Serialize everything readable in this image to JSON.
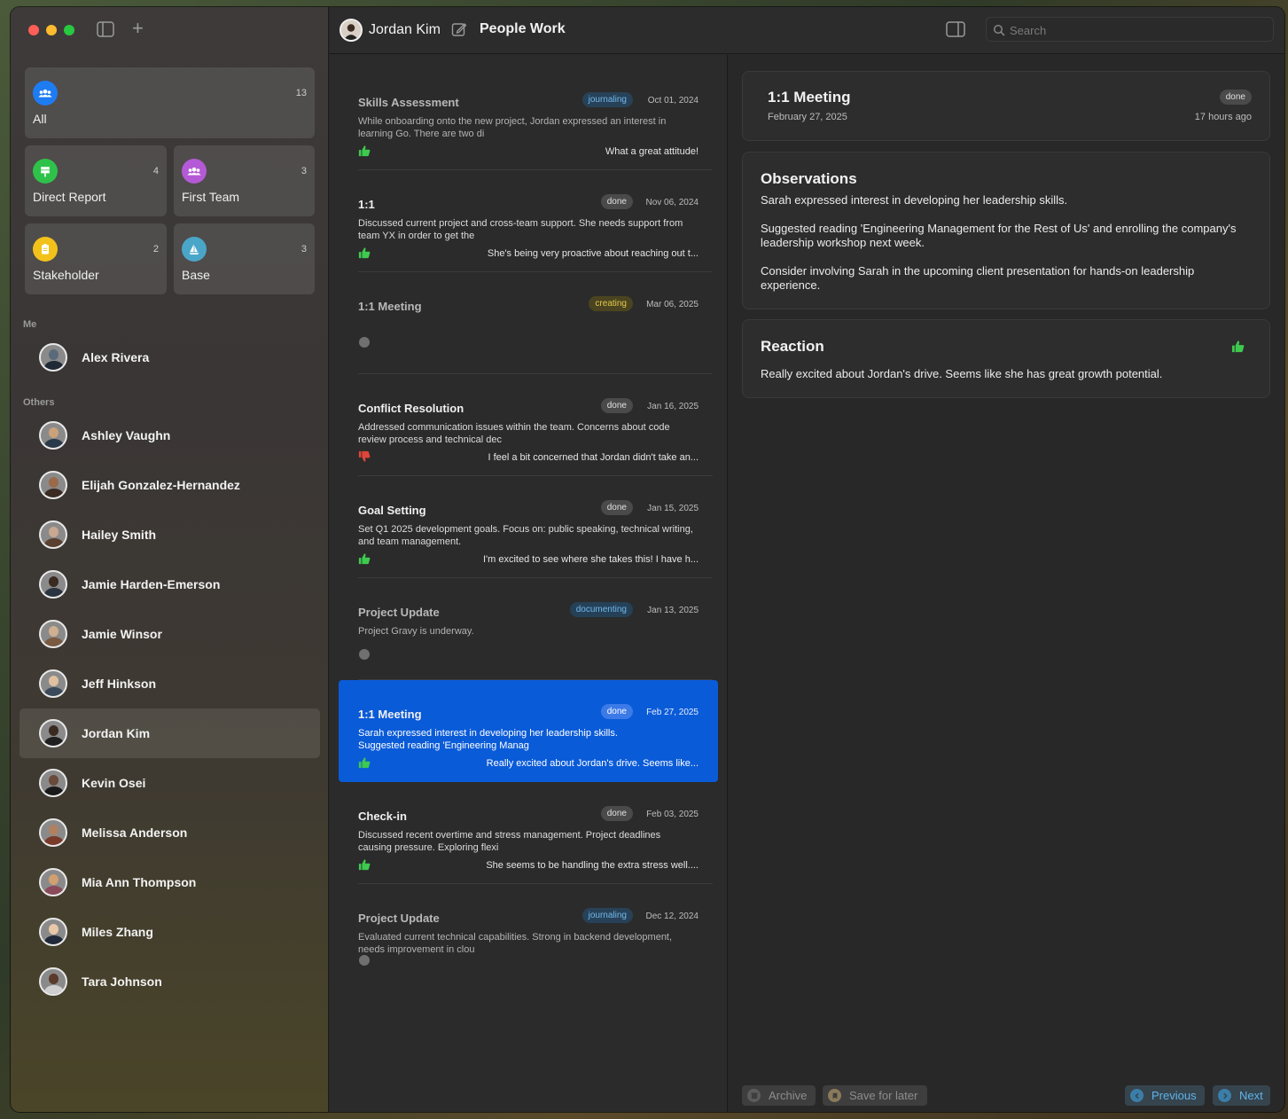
{
  "header": {
    "person_name": "Jordan Kim",
    "app_title": "People Work",
    "search_placeholder": "Search"
  },
  "sidebar": {
    "groups": [
      {
        "label": "All",
        "count": "13",
        "color": "#1e7cf2",
        "icon": "people-group-icon"
      },
      {
        "label": "Direct Report",
        "count": "4",
        "color": "#2fc24a",
        "icon": "signpost-icon"
      },
      {
        "label": "First Team",
        "count": "3",
        "color": "#b45ad6",
        "icon": "people-group-icon"
      },
      {
        "label": "Stakeholder",
        "count": "2",
        "color": "#f2c21a",
        "icon": "clipboard-icon"
      },
      {
        "label": "Base",
        "count": "3",
        "color": "#4aa6c8",
        "icon": "sailboat-icon"
      }
    ],
    "me_label": "Me",
    "me": [
      {
        "name": "Alex Rivera"
      }
    ],
    "others_label": "Others",
    "others": [
      {
        "name": "Ashley Vaughn"
      },
      {
        "name": "Elijah Gonzalez-Hernandez"
      },
      {
        "name": "Hailey Smith"
      },
      {
        "name": "Jamie Harden-Emerson"
      },
      {
        "name": "Jamie Winsor"
      },
      {
        "name": "Jeff Hinkson"
      },
      {
        "name": "Jordan Kim",
        "selected": true
      },
      {
        "name": "Kevin Osei"
      },
      {
        "name": "Melissa Anderson"
      },
      {
        "name": "Mia Ann Thompson"
      },
      {
        "name": "Miles Zhang"
      },
      {
        "name": "Tara Johnson"
      }
    ]
  },
  "list": {
    "items": [
      {
        "title": "Skills Assessment",
        "status": "journaling",
        "date": "Oct 01, 2024",
        "snippet": "While onboarding onto the new project, Jordan expressed an interest in learning Go. There are two di",
        "reaction": "What a great attitude!",
        "sentiment": "positive"
      },
      {
        "title": "1:1",
        "status": "done",
        "date": "Nov 06, 2024",
        "snippet": "Discussed current project and cross-team support. She needs support from team YX in order to get the",
        "reaction": "She's being very proactive about reaching out t...",
        "sentiment": "positive"
      },
      {
        "title": "1:1 Meeting",
        "status": "creating",
        "date": "Mar 06, 2025",
        "snippet": "",
        "reaction": "",
        "sentiment": "none"
      },
      {
        "title": "Conflict Resolution",
        "status": "done",
        "date": "Jan 16, 2025",
        "snippet": "Addressed communication issues within the team. Concerns about code review process and technical dec",
        "reaction": "I feel a bit concerned that Jordan didn't take an...",
        "sentiment": "negative"
      },
      {
        "title": "Goal Setting",
        "status": "done",
        "date": "Jan 15, 2025",
        "snippet": "Set Q1 2025 development goals.   Focus on: public speaking, technical writing, and team management.",
        "reaction": "I'm excited to see where she takes this! I have h...",
        "sentiment": "positive"
      },
      {
        "title": "Project Update",
        "status": "documenting",
        "date": "Jan 13, 2025",
        "snippet": "Project Gravy is underway.",
        "reaction": "",
        "sentiment": "none"
      },
      {
        "title": "1:1 Meeting",
        "status": "done",
        "date": "Feb 27, 2025",
        "snippet": "Sarah expressed interest in developing her leadership skills.\nSuggested reading 'Engineering Manag",
        "reaction": "Really excited about Jordan's drive. Seems like...",
        "sentiment": "positive",
        "selected": true
      },
      {
        "title": "Check-in",
        "status": "done",
        "date": "Feb 03, 2025",
        "snippet": "Discussed recent overtime and stress management. Project deadlines causing pressure. Exploring flexi",
        "reaction": "She seems to be handling the extra stress well....",
        "sentiment": "positive"
      },
      {
        "title": "Project Update",
        "status": "journaling",
        "date": "Dec 12, 2024",
        "snippet": "Evaluated current technical capabilities.   Strong in backend development, needs improvement in clou",
        "reaction": "",
        "sentiment": "none"
      }
    ]
  },
  "detail": {
    "title": "1:1 Meeting",
    "date": "February 27, 2025",
    "status": "done",
    "ago": "17 hours ago",
    "observations_title": "Observations",
    "observations": [
      "Sarah expressed interest in developing her leadership skills.",
      "Suggested reading 'Engineering Management for the Rest of Us' and enrolling the company's leadership workshop next week.",
      "Consider involving Sarah in the upcoming client presentation for hands-on leadership experience."
    ],
    "reaction_title": "Reaction",
    "reaction": "Really excited about Jordan's drive. Seems like she has great growth potential.",
    "reaction_sentiment": "positive"
  },
  "footer": {
    "archive_label": "Archive",
    "save_label": "Save for later",
    "previous_label": "Previous",
    "next_label": "Next"
  },
  "colors": {
    "accent": "#0a5bd8",
    "positive": "#3ec94f",
    "negative": "#e0453a"
  }
}
